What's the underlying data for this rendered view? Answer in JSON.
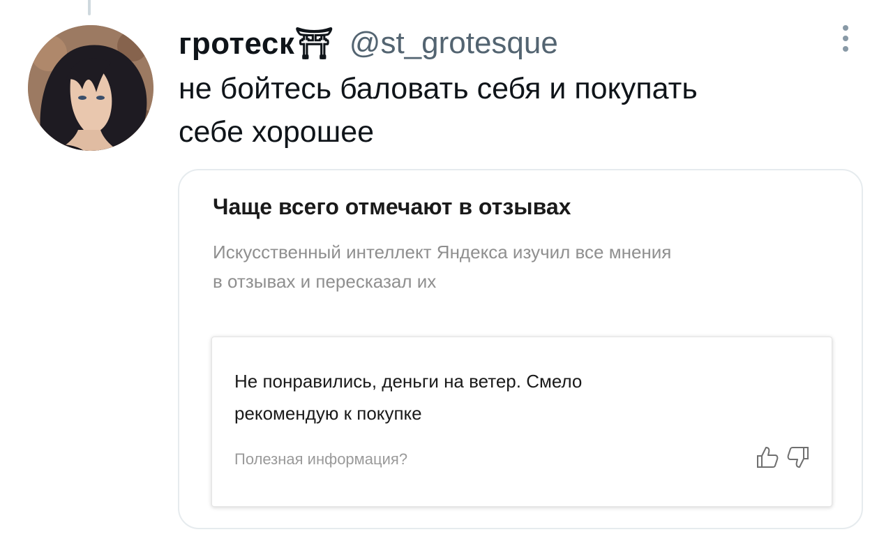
{
  "tweet": {
    "author": {
      "display_name": "гротеск⛩",
      "handle": "@st_grotesque",
      "avatar_icon": "avatar-portrait"
    },
    "text": "не бойтесь баловать себя и покупать\nсебе хорошее",
    "more_icon": "more-vertical-icon"
  },
  "media_card": {
    "title": "Чаще всего отмечают в отзывах",
    "subtitle": "Искусственный интеллект Яндекса изучил все мнения\nв отзывах и пересказал их",
    "review": {
      "text": "Не понравились, деньги на ветер. Смело\nрекомендую к покупке",
      "helpful_label": "Полезная информация?",
      "vote_up_icon": "thumbs-up-icon",
      "vote_down_icon": "thumbs-down-icon"
    }
  },
  "colors": {
    "text_primary": "#0f1419",
    "text_secondary": "#536471",
    "card_border": "#e6ebee",
    "muted_gray": "#8f8f8f"
  }
}
